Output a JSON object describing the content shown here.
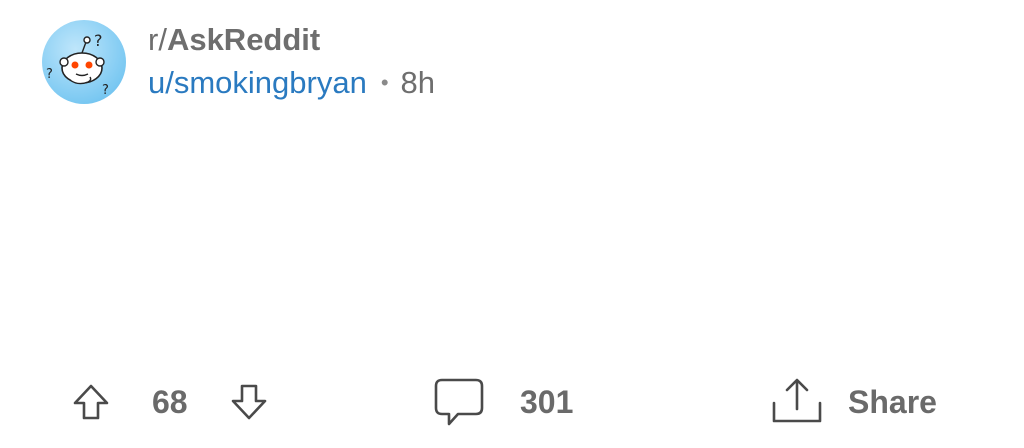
{
  "post": {
    "subreddit_prefix": "r/",
    "subreddit_name": "AskReddit",
    "author": "u/smokingbryan",
    "separator": "•",
    "age": "8h"
  },
  "actions": {
    "upvote_count": "68",
    "comment_count": "301",
    "share_label": "Share"
  },
  "icons": {
    "avatar": "subreddit-avatar-confused-snoo",
    "upvote": "arrow-up-icon",
    "downvote": "arrow-down-icon",
    "comment": "speech-bubble-icon",
    "share": "share-upload-icon"
  },
  "colors": {
    "username": "#2a7ac0",
    "muted_text": "#6e6e6e",
    "icon_stroke": "#4a4a4a",
    "avatar_bg": "#7cc9f2"
  }
}
